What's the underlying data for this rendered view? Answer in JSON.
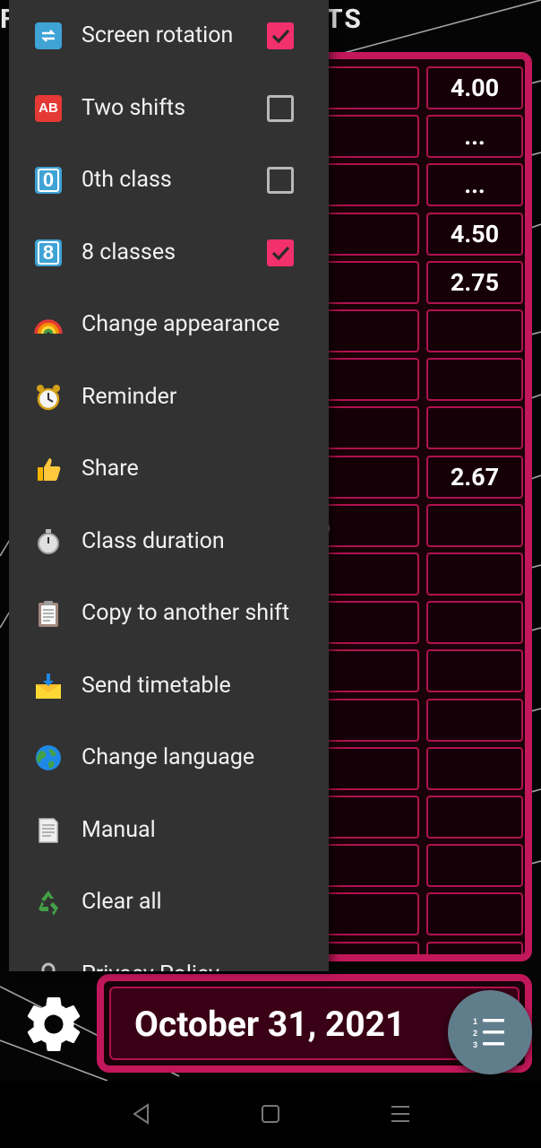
{
  "app": {
    "title_partial_left": "F",
    "title_partial_right": "TS"
  },
  "grades": {
    "values": [
      "4.00",
      "...",
      "...",
      "4.50",
      "2.75",
      "",
      "",
      "",
      "2.67",
      "",
      "",
      "",
      "",
      "",
      "",
      "",
      "",
      "",
      "",
      ""
    ],
    "partial_char": ")"
  },
  "drawer": {
    "items": [
      {
        "label": "Screen rotation",
        "icon": "screen-rotation-icon",
        "checkbox": true
      },
      {
        "label": "Two shifts",
        "icon": "ab-icon",
        "checkbox": false
      },
      {
        "label": "0th class",
        "icon": "keycap-0-icon",
        "checkbox": false
      },
      {
        "label": "8 classes",
        "icon": "keycap-8-icon",
        "checkbox": true
      },
      {
        "label": "Change appearance",
        "icon": "rainbow-icon"
      },
      {
        "label": "Reminder",
        "icon": "alarm-clock-icon"
      },
      {
        "label": "Share",
        "icon": "thumbs-up-icon"
      },
      {
        "label": "Class duration",
        "icon": "stopwatch-icon"
      },
      {
        "label": "Copy to another shift",
        "icon": "clipboard-icon"
      },
      {
        "label": "Send timetable",
        "icon": "inbox-tray-icon"
      },
      {
        "label": "Change language",
        "icon": "globe-icon"
      },
      {
        "label": "Manual",
        "icon": "document-icon"
      },
      {
        "label": "Clear all",
        "icon": "recycle-icon"
      },
      {
        "label": "Privacy Policy",
        "icon": "lock-icon"
      }
    ]
  },
  "bottom": {
    "date": "October 31, 2021"
  },
  "colors": {
    "accent": "#c2185b",
    "checkbox": "#f2306b",
    "drawer_bg": "#323232",
    "fab": "#607d8b"
  }
}
